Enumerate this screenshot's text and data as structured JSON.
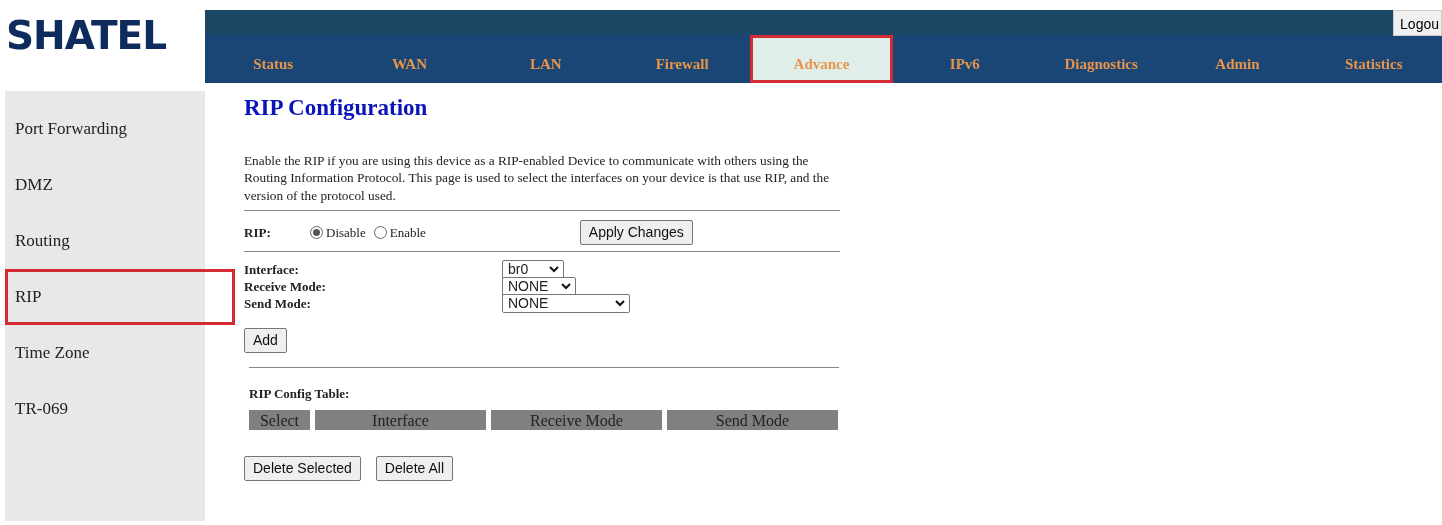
{
  "logo": "SHATEL",
  "logout": "Logou",
  "tabs": [
    {
      "label": "Status",
      "selected": false
    },
    {
      "label": "WAN",
      "selected": false
    },
    {
      "label": "LAN",
      "selected": false
    },
    {
      "label": "Firewall",
      "selected": false
    },
    {
      "label": "Advance",
      "selected": true
    },
    {
      "label": "IPv6",
      "selected": false
    },
    {
      "label": "Diagnostics",
      "selected": false
    },
    {
      "label": "Admin",
      "selected": false
    },
    {
      "label": "Statistics",
      "selected": false
    }
  ],
  "sidebar": {
    "items": [
      {
        "label": "Port Forwarding",
        "selected": false
      },
      {
        "label": "DMZ",
        "selected": false
      },
      {
        "label": "Routing",
        "selected": false
      },
      {
        "label": "RIP",
        "selected": true
      },
      {
        "label": "Time Zone",
        "selected": false
      },
      {
        "label": "TR-069",
        "selected": false
      }
    ]
  },
  "title": "RIP Configuration",
  "description": "Enable the RIP if you are using this device as a RIP-enabled Device to communicate with others using the Routing Information Protocol. This page is used to select the interfaces on your device is that use RIP, and the version of the protocol used.",
  "rip": {
    "label": "RIP:",
    "options": [
      {
        "label": "Disable",
        "selected": true
      },
      {
        "label": "Enable",
        "selected": false
      }
    ],
    "apply_button": "Apply Changes"
  },
  "fields": [
    {
      "label": "Interface:",
      "value": "br0",
      "kind": "short"
    },
    {
      "label": "Receive Mode:",
      "value": "NONE",
      "kind": "narrow"
    },
    {
      "label": "Send Mode:",
      "value": "NONE",
      "kind": "wide"
    }
  ],
  "add_button": "Add",
  "table": {
    "title": "RIP Config Table:",
    "columns": [
      "Select",
      "Interface",
      "Receive Mode",
      "Send Mode"
    ]
  },
  "buttons": [
    "Delete Selected",
    "Delete All"
  ]
}
